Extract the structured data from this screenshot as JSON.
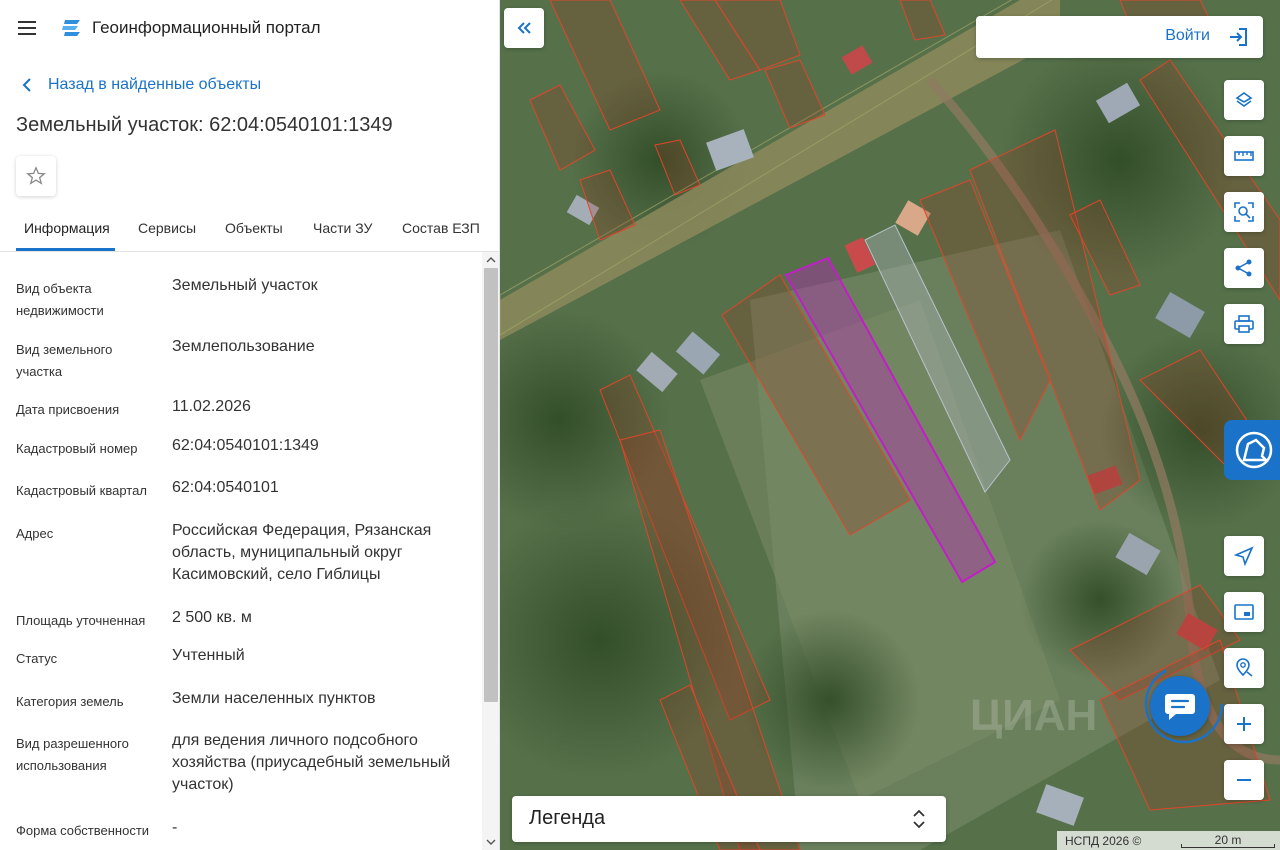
{
  "header": {
    "app_title": "Геоинформационный портал",
    "menu_icon": "menu-icon",
    "logo_icon": "portal-logo-icon"
  },
  "back_link": {
    "label": "Назад в найденные объекты"
  },
  "object": {
    "title": "Земельный участок: 62:04:0540101:1349"
  },
  "tabs": [
    {
      "label": "Информация",
      "active": true
    },
    {
      "label": "Сервисы"
    },
    {
      "label": "Объекты"
    },
    {
      "label": "Части ЗУ"
    },
    {
      "label": "Состав ЕЗП"
    }
  ],
  "properties": [
    {
      "label": "Вид объекта недвижимости",
      "value": "Земельный участок"
    },
    {
      "label": "Вид земельного участка",
      "value": "Землепользование"
    },
    {
      "label": "Дата присвоения",
      "value": "11.02.2026"
    },
    {
      "label": "Кадастровый номер",
      "value": "62:04:0540101:1349"
    },
    {
      "label": "Кадастровый квартал",
      "value": "62:04:0540101"
    },
    {
      "label": "Адрес",
      "value": "Российская Федерация, Рязанская область, муниципальный округ Касимовский, село Гиблицы"
    },
    {
      "label": "Площадь уточненная",
      "value": "2 500 кв. м"
    },
    {
      "label": "Статус",
      "value": "Учтенный"
    },
    {
      "label": "Категория земель",
      "value": "Земли населенных пунктов"
    },
    {
      "label": "Вид разрешенного использования",
      "value": "для ведения личного подсобного хозяйства (приусадебный земельный участок)"
    },
    {
      "label": "Форма собственности",
      "value": "-"
    }
  ],
  "map": {
    "login_label": "Войти",
    "legend_label": "Легенда",
    "copyright": "НСПД 2026 ©",
    "scale_label": "20 m",
    "watermark": "ЦИАН",
    "tools": [
      "layers-icon",
      "ruler-icon",
      "area-select-icon",
      "share-icon",
      "print-icon",
      "locate-icon",
      "minimap-icon",
      "geo-search-icon",
      "zoom-in-icon",
      "zoom-out-icon"
    ],
    "colors": {
      "accent": "#1a73c8",
      "parcel_border": "#e0452a",
      "selected_parcel": "#c21ec8"
    }
  }
}
